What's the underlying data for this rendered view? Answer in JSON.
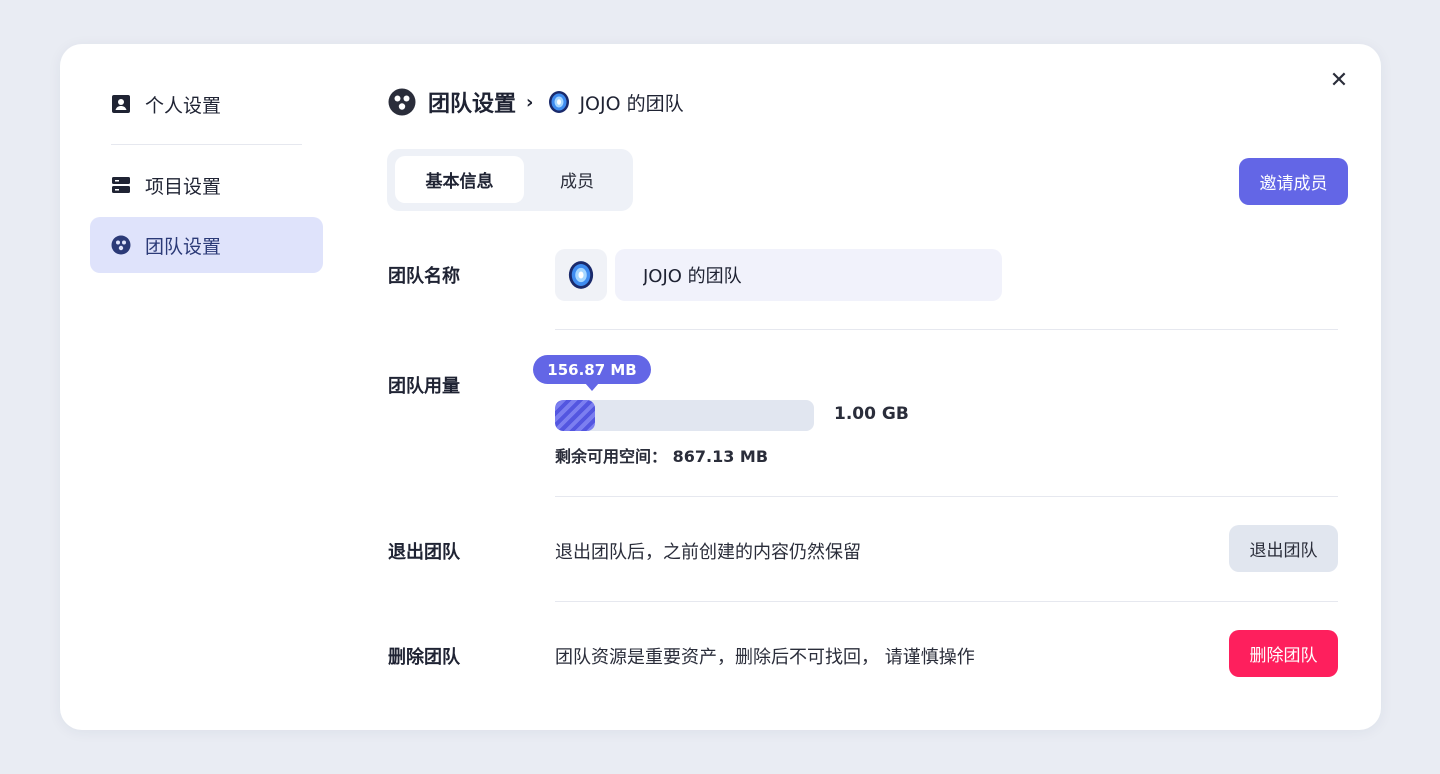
{
  "sidebar": {
    "items": [
      {
        "label": "个人设置",
        "icon": "user-card-icon"
      },
      {
        "label": "项目设置",
        "icon": "server-icon"
      },
      {
        "label": "团队设置",
        "icon": "team-icon",
        "active": true
      }
    ]
  },
  "header": {
    "section": "团队设置",
    "separator": "›",
    "team_name": "JOJO 的团队"
  },
  "tabs": [
    {
      "label": "基本信息",
      "active": true
    },
    {
      "label": "成员",
      "active": false
    }
  ],
  "invite_button": "邀请成员",
  "team_name_row": {
    "label": "团队名称",
    "value": "JOJO 的团队"
  },
  "usage": {
    "label": "团队用量",
    "used": "156.87 MB",
    "total": "1.00 GB",
    "remaining_label": "剩余可用空间：",
    "remaining_value": "867.13 MB",
    "fill_fraction": 0.153
  },
  "leave": {
    "label": "退出团队",
    "desc": "退出团队后，之前创建的内容仍然保留",
    "button": "退出团队"
  },
  "delete": {
    "label": "删除团队",
    "desc": "团队资源是重要资产，删除后不可找回， 请谨慎操作",
    "button": "删除团队"
  },
  "colors": {
    "accent": "#6366e6",
    "danger": "#fe1f5d",
    "active_bg": "#dfe3fb"
  }
}
